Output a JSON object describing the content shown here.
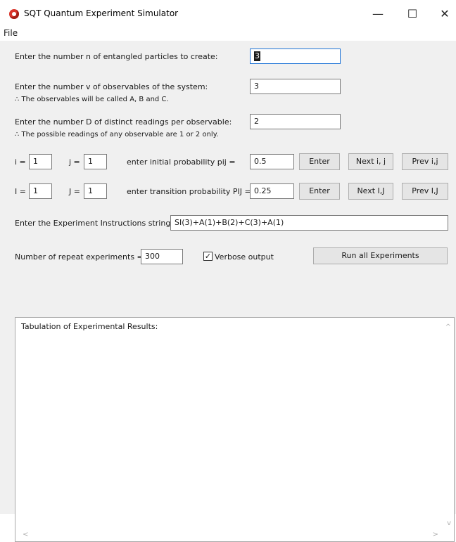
{
  "window": {
    "title": "SQT Quantum Experiment Simulator",
    "minimize": "—",
    "maximize": "☐",
    "close": "✕"
  },
  "menu": {
    "file": "File"
  },
  "particles": {
    "label": "Enter the number n of entangled particles to create:",
    "value": "3"
  },
  "observables": {
    "label": "Enter the number v of observables of the system:",
    "value": "3",
    "note": "∴ The observables will be called A, B and C."
  },
  "readings": {
    "label": "Enter the number D of distinct readings per observable:",
    "value": "2",
    "note": "∴ The possible readings of any observable are 1 or 2 only."
  },
  "initial": {
    "i_label": "i =",
    "i_value": "1",
    "j_label": "j =",
    "j_value": "1",
    "prob_label": "enter initial probability pij =",
    "prob_value": "0.5",
    "enter_button": "Enter",
    "next_button": "Next i, j",
    "prev_button": "Prev i,j"
  },
  "transition": {
    "I_label": "I =",
    "I_value": "1",
    "J_label": "J =",
    "J_value": "1",
    "prob_label": "enter transition probability PIJ =",
    "prob_value": "0.25",
    "enter_button": "Enter",
    "next_button": "Next I,J",
    "prev_button": "Prev I,J"
  },
  "instructions": {
    "label": "Enter the Experiment Instructions string:",
    "value": "SI(3)+A(1)+B(2)+C(3)+A(1)"
  },
  "repeat": {
    "label": "Number of repeat experiments =",
    "value": "300",
    "verbose_label": "Verbose output",
    "verbose_checked": "✓",
    "run_button": "Run all Experiments"
  },
  "results": {
    "label": "Tabulation of Experimental Results:",
    "scroll_up": "^",
    "scroll_down": "v",
    "scroll_left": "<",
    "scroll_right": ">"
  }
}
